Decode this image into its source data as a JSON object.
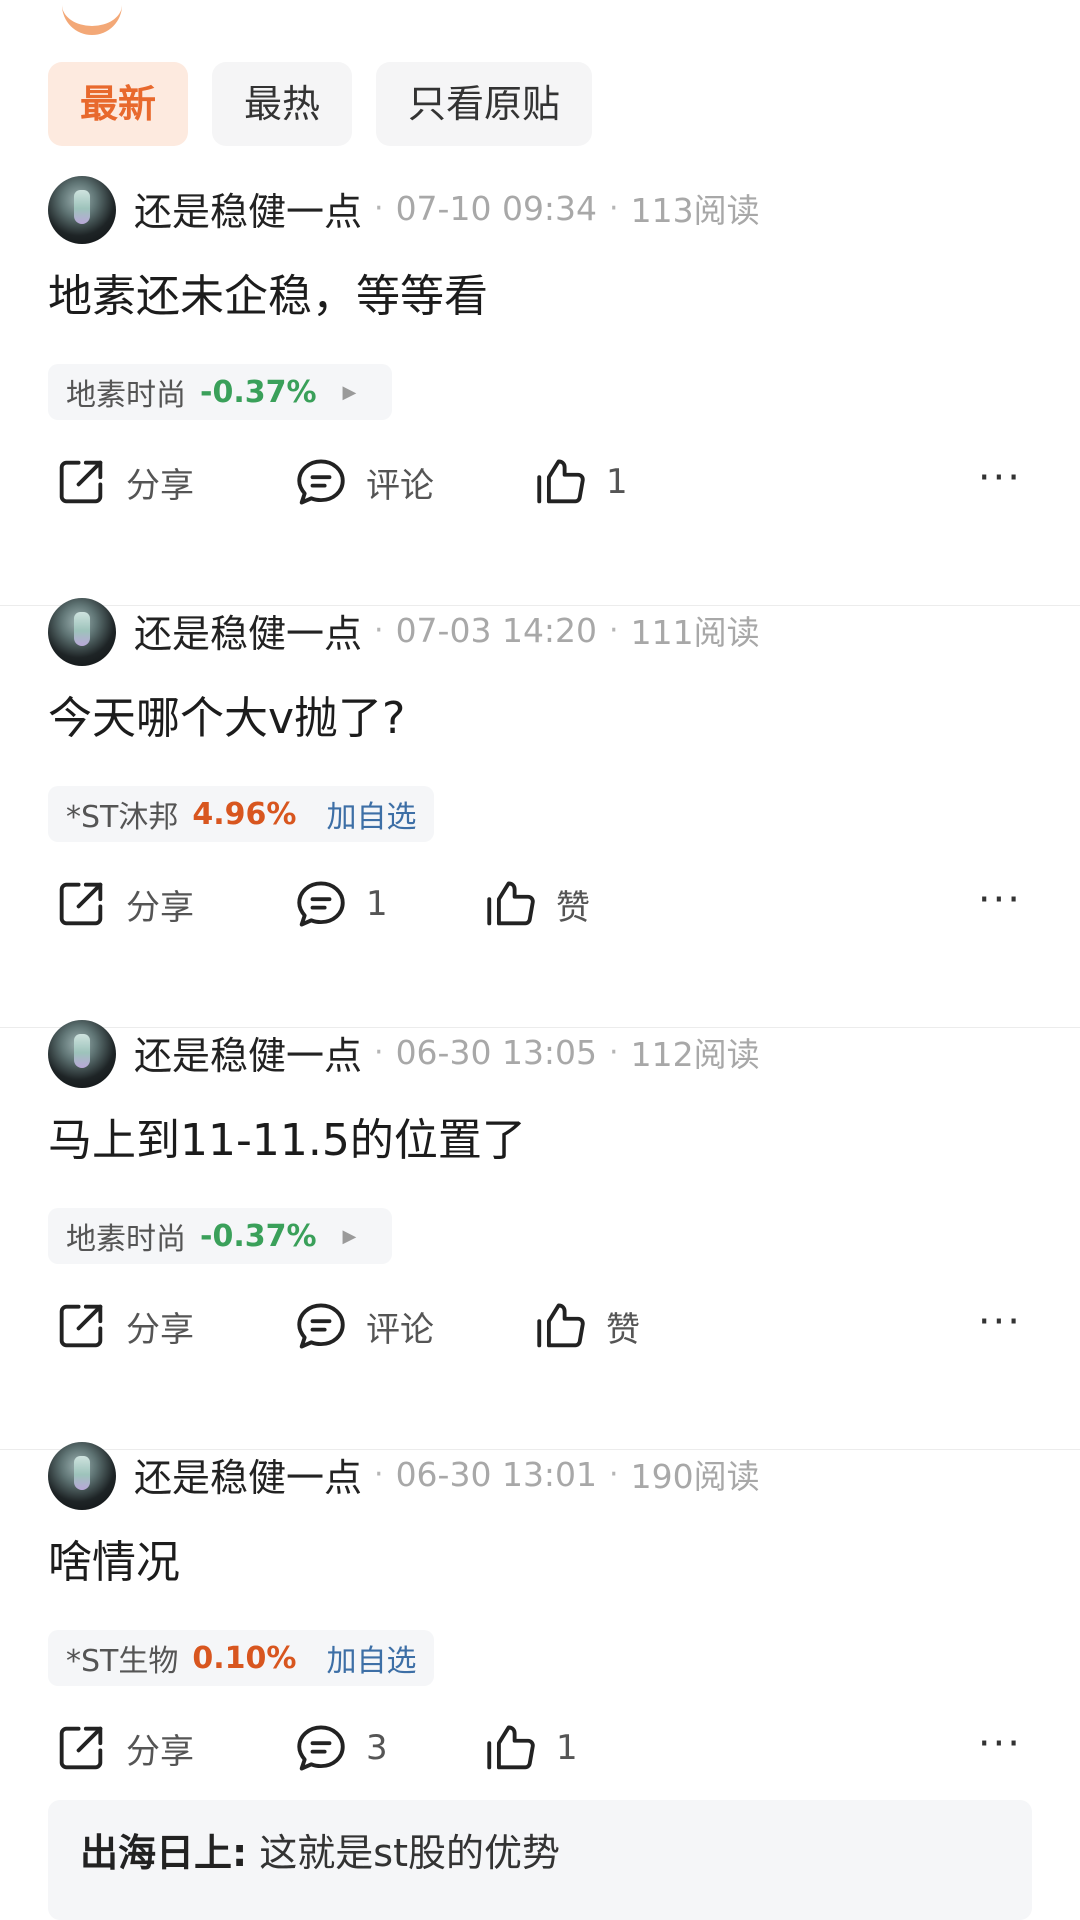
{
  "tabs": [
    {
      "label": "最新",
      "active": true
    },
    {
      "label": "最热",
      "active": false
    },
    {
      "label": "只看原贴",
      "active": false
    }
  ],
  "colors": {
    "accent": "#e8692d",
    "accent_bg": "#fdeadf",
    "stock_down": "#3aa05a",
    "stock_up": "#d8561f",
    "link": "#3d6fa6"
  },
  "posts": [
    {
      "author": "还是稳健一点",
      "time": "07-10 09:34",
      "reads": "113阅读",
      "content": "地素还未企稳，等等看",
      "stock": {
        "name": "地素时尚",
        "change": "-0.37%",
        "direction": "down",
        "arrow_icon": "play-right-icon",
        "action": ""
      },
      "share_label": "分享",
      "comment_label": "评论",
      "like_label": "1"
    },
    {
      "author": "还是稳健一点",
      "time": "07-03 14:20",
      "reads": "111阅读",
      "content": "今天哪个大v抛了?",
      "stock": {
        "name": "*ST沐邦",
        "change": "4.96%",
        "direction": "up",
        "action": "加自选"
      },
      "share_label": "分享",
      "comment_label": "1",
      "like_label": "赞"
    },
    {
      "author": "还是稳健一点",
      "time": "06-30 13:05",
      "reads": "112阅读",
      "content": "马上到11-11.5的位置了",
      "stock": {
        "name": "地素时尚",
        "change": "-0.37%",
        "direction": "down",
        "arrow_icon": "play-right-icon",
        "action": ""
      },
      "share_label": "分享",
      "comment_label": "评论",
      "like_label": "赞"
    },
    {
      "author": "还是稳健一点",
      "time": "06-30 13:01",
      "reads": "190阅读",
      "content": "啥情况",
      "stock": {
        "name": "*ST生物",
        "change": "0.10%",
        "direction": "up",
        "action": "加自选"
      },
      "share_label": "分享",
      "comment_label": "3",
      "like_label": "1"
    }
  ],
  "reply_preview": {
    "author": "出海日上:",
    "text": "这就是st股的优势"
  },
  "more_glyph": "···"
}
